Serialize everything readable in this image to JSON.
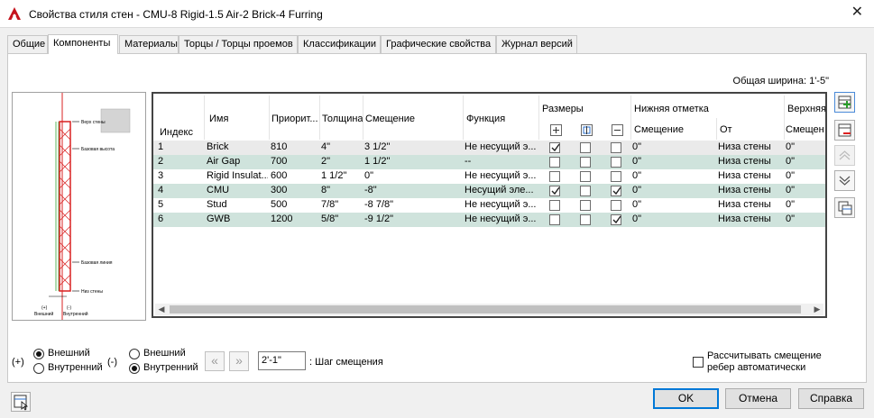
{
  "window": {
    "title": "Свойства стиля стен - CMU-8 Rigid-1.5 Air-2 Brick-4 Furring"
  },
  "tabs": [
    {
      "label": "Общие"
    },
    {
      "label": "Компоненты",
      "active": true
    },
    {
      "label": "Материалы"
    },
    {
      "label": "Торцы / Торцы проемов"
    },
    {
      "label": "Классификации"
    },
    {
      "label": "Графические свойства"
    },
    {
      "label": "Журнал версий"
    }
  ],
  "total_width": "Общая ширина: 1'-5\"",
  "preview": {
    "labels": {
      "top": "Верх стены",
      "base_high": "Базовая высота",
      "base_low": "Базовая линия",
      "bottom": "Низ стены",
      "plus": "(+)",
      "minus": "(-)",
      "exterior": "Внешний",
      "interior": "Внутренний"
    }
  },
  "grid": {
    "headers": {
      "index": "Индекс",
      "name": "Имя",
      "priority": "Приорит...",
      "thickness": "Толщина",
      "offset": "Смещение",
      "function": "Функция",
      "dimensions": "Размеры",
      "bottom_elevation": "Нижняя отметка",
      "bottom_offset": "Смещение",
      "bottom_from": "От",
      "top_elevation": "Верхняя",
      "top_offset": "Смещен"
    },
    "rows": [
      {
        "index": "1",
        "name": "Brick",
        "priority": "810",
        "thickness": "4\"",
        "offset": "3 1/2\"",
        "function": "Не несущий э...",
        "dim1": true,
        "dim2": false,
        "dim3": false,
        "bottom_offset": "0\"",
        "bottom_from": "Низа стены",
        "top_offset": "0\""
      },
      {
        "index": "2",
        "name": "Air Gap",
        "priority": "700",
        "thickness": "2\"",
        "offset": "1 1/2\"",
        "function": "--",
        "dim1": false,
        "dim2": false,
        "dim3": false,
        "bottom_offset": "0\"",
        "bottom_from": "Низа стены",
        "top_offset": "0\""
      },
      {
        "index": "3",
        "name": "Rigid Insulat...",
        "priority": "600",
        "thickness": "1 1/2\"",
        "offset": "0\"",
        "function": "Не несущий э...",
        "dim1": false,
        "dim2": false,
        "dim3": false,
        "bottom_offset": "0\"",
        "bottom_from": "Низа стены",
        "top_offset": "0\""
      },
      {
        "index": "4",
        "name": "CMU",
        "priority": "300",
        "thickness": "8\"",
        "offset": "-8\"",
        "function": "Несущий эле...",
        "dim1": true,
        "dim2": false,
        "dim3": true,
        "bottom_offset": "0\"",
        "bottom_from": "Низа стены",
        "top_offset": "0\""
      },
      {
        "index": "5",
        "name": "Stud",
        "priority": "500",
        "thickness": "7/8\"",
        "offset": "-8 7/8\"",
        "function": "Не несущий э...",
        "dim1": false,
        "dim2": false,
        "dim3": false,
        "bottom_offset": "0\"",
        "bottom_from": "Низа стены",
        "top_offset": "0\""
      },
      {
        "index": "6",
        "name": "GWB",
        "priority": "1200",
        "thickness": "5/8\"",
        "offset": "-9 1/2\"",
        "function": "Не несущий э...",
        "dim1": false,
        "dim2": false,
        "dim3": true,
        "bottom_offset": "0\"",
        "bottom_from": "Низа стены",
        "top_offset": "0\""
      }
    ]
  },
  "side_buttons": [
    {
      "icon": "add-component-icon"
    },
    {
      "icon": "remove-component-icon"
    },
    {
      "icon": "move-up-icon"
    },
    {
      "icon": "move-down-icon"
    },
    {
      "icon": "copy-component-icon"
    }
  ],
  "plus_side": {
    "symbol": "(+)",
    "option1": "Внешний",
    "option2": "Внутренний",
    "selected": "Внешний"
  },
  "minus_side": {
    "symbol": "(-)",
    "option1": "Внешний",
    "option2": "Внутренний",
    "selected": "Внутренний"
  },
  "offset_step": {
    "value": "2'-1\"",
    "label": ": Шаг смещения",
    "label_underline": "Ш"
  },
  "auto_offset": {
    "line1": "Рассчитывать смещение",
    "line2": "ребер автоматически",
    "checked": false
  },
  "buttons": {
    "ok": "OK",
    "cancel": "Отмена",
    "help": "Справка"
  },
  "colors": {
    "selected_row": "#cfe3dc",
    "accent": "#0078d7",
    "app_icon": "#c5141d"
  }
}
